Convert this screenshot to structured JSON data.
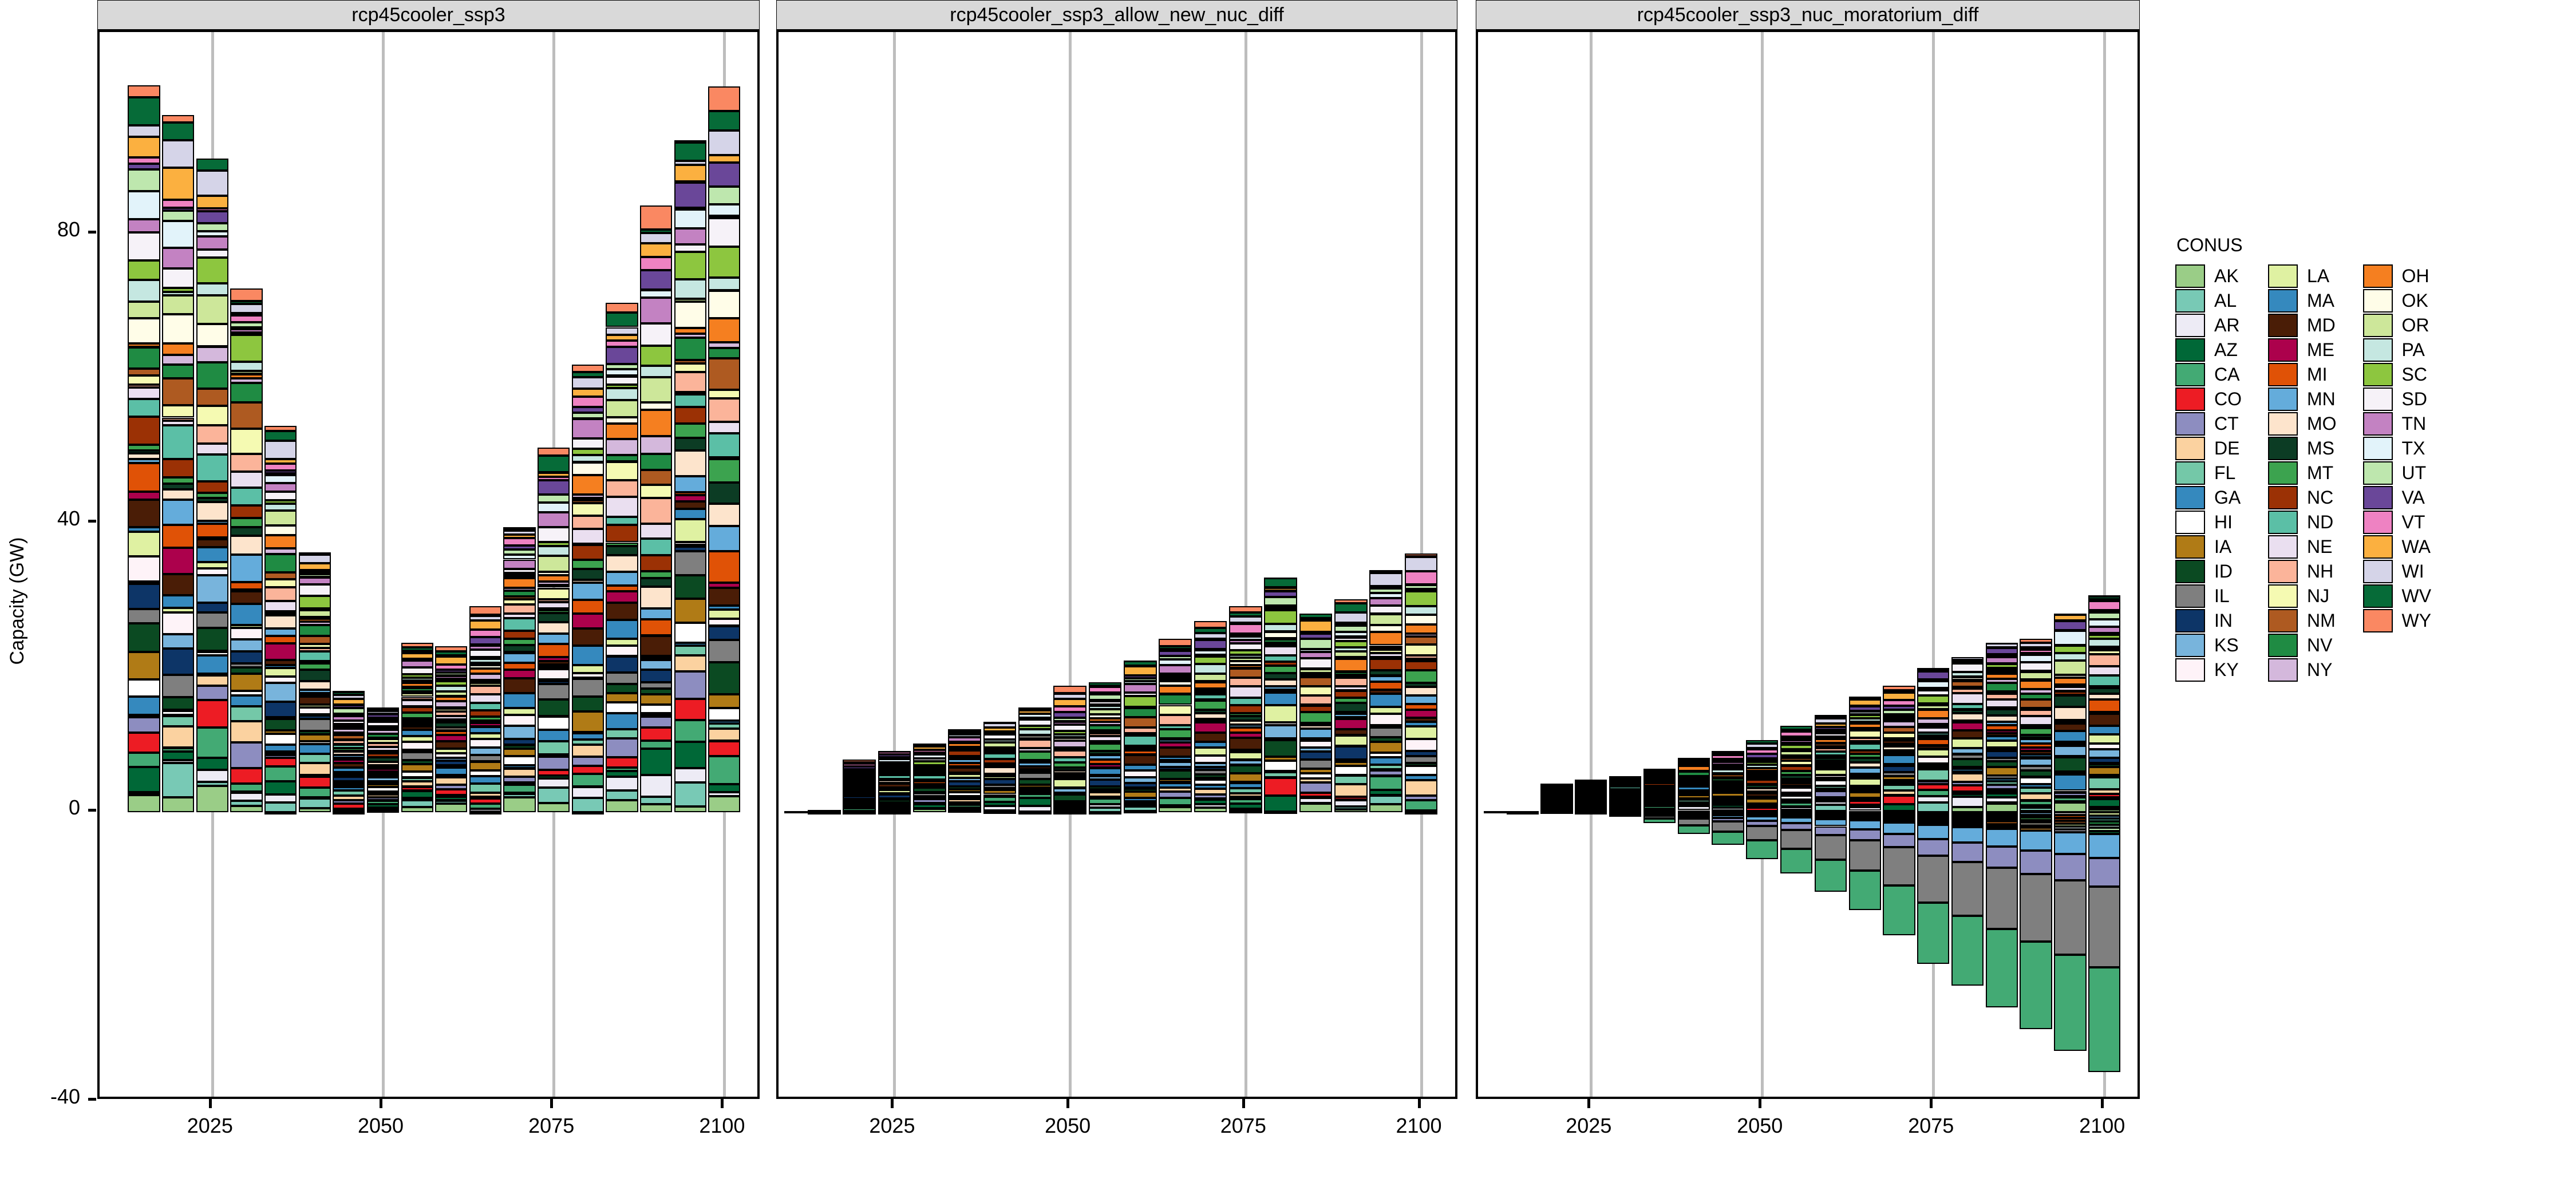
{
  "axes": {
    "ylabel": "Capacity (GW)",
    "yticks": [
      80,
      40,
      0,
      -40
    ],
    "ytick_labels": [
      "80",
      "40",
      "0",
      "-40"
    ],
    "ylim": [
      -40,
      108
    ],
    "xticks": [
      2025,
      2050,
      2075,
      2100
    ],
    "xtick_labels": [
      "2025",
      "2050",
      "2075",
      "2100"
    ],
    "xlim": [
      2008,
      2106
    ]
  },
  "legend": {
    "title": "CONUS",
    "columns": [
      [
        {
          "label": "AK",
          "color": "#9ACD87"
        },
        {
          "label": "AL",
          "color": "#78C9B5"
        },
        {
          "label": "AR",
          "color": "#EDEBF5"
        },
        {
          "label": "AZ",
          "color": "#006837"
        },
        {
          "label": "CA",
          "color": "#43AA74"
        },
        {
          "label": "CO",
          "color": "#ED1C24"
        },
        {
          "label": "CT",
          "color": "#8D8DC0"
        },
        {
          "label": "DE",
          "color": "#FBD2A0"
        },
        {
          "label": "FL",
          "color": "#74C8A8"
        },
        {
          "label": "GA",
          "color": "#3589BE"
        },
        {
          "label": "HI",
          "color": "#FFFFFF"
        },
        {
          "label": "IA",
          "color": "#B07B16"
        },
        {
          "label": "ID",
          "color": "#0B4A22"
        },
        {
          "label": "IL",
          "color": "#7F7F7F"
        },
        {
          "label": "IN",
          "color": "#0D3567"
        },
        {
          "label": "KS",
          "color": "#78B4DC"
        },
        {
          "label": "KY",
          "color": "#FEF3F8"
        }
      ],
      [
        {
          "label": "LA",
          "color": "#DFF1A2"
        },
        {
          "label": "MA",
          "color": "#3589BE"
        },
        {
          "label": "MD",
          "color": "#4A1D06"
        },
        {
          "label": "ME",
          "color": "#AC014C"
        },
        {
          "label": "MI",
          "color": "#E05206"
        },
        {
          "label": "MN",
          "color": "#64ACDB"
        },
        {
          "label": "MO",
          "color": "#FDE4CC"
        },
        {
          "label": "MS",
          "color": "#0C3C24"
        },
        {
          "label": "MT",
          "color": "#3CA34F"
        },
        {
          "label": "NC",
          "color": "#9B3105"
        },
        {
          "label": "ND",
          "color": "#5BBFA6"
        },
        {
          "label": "NE",
          "color": "#EADFF0"
        },
        {
          "label": "NH",
          "color": "#FBB49A"
        },
        {
          "label": "NJ",
          "color": "#F5FAB2"
        },
        {
          "label": "NM",
          "color": "#AE5A21"
        },
        {
          "label": "NV",
          "color": "#1F8B43"
        },
        {
          "label": "NY",
          "color": "#D4B8DC"
        }
      ],
      [
        {
          "label": "OH",
          "color": "#F57F20"
        },
        {
          "label": "OK",
          "color": "#FFFDE8"
        },
        {
          "label": "OR",
          "color": "#CDE79A"
        },
        {
          "label": "PA",
          "color": "#C5E7E1"
        },
        {
          "label": "SC",
          "color": "#8DC63F"
        },
        {
          "label": "SD",
          "color": "#F6F2F8"
        },
        {
          "label": "TN",
          "color": "#C382C2"
        },
        {
          "label": "TX",
          "color": "#E2F3FA"
        },
        {
          "label": "UT",
          "color": "#BEE7AE"
        },
        {
          "label": "VA",
          "color": "#6A4799"
        },
        {
          "label": "VT",
          "color": "#EE82C2"
        },
        {
          "label": "WA",
          "color": "#FBB040"
        },
        {
          "label": "WI",
          "color": "#D5D4E8"
        },
        {
          "label": "WV",
          "color": "#066B38"
        },
        {
          "label": "WY",
          "color": "#FA8862"
        }
      ]
    ]
  },
  "chart_data": {
    "type": "bar",
    "title": "",
    "xlabel": "",
    "ylabel": "Capacity (GW)",
    "stacked": true,
    "grid": "vertical",
    "legend_position": "right",
    "facets": [
      "rcp45cooler_ssp3",
      "rcp45cooler_ssp3_allow_new_nuc_diff",
      "rcp45cooler_ssp3_nuc_moratorium_diff"
    ],
    "x": [
      2015,
      2020,
      2025,
      2030,
      2035,
      2040,
      2045,
      2050,
      2055,
      2060,
      2065,
      2070,
      2075,
      2080,
      2085,
      2090,
      2095,
      2100
    ],
    "panels": [
      {
        "name": "rcp45cooler_ssp3",
        "totals": [
          100.6,
          96.5,
          90.5,
          72.5,
          53.5,
          36.0,
          16.8,
          14.5,
          23.5,
          23.0,
          28.5,
          39.5,
          50.5,
          62.0,
          70.5,
          84.0,
          93.0,
          100.5
        ],
        "negatives": [
          0,
          0,
          0,
          0,
          0,
          0,
          0,
          0,
          0,
          0,
          0,
          0,
          0,
          0,
          0,
          0,
          0,
          0
        ]
      },
      {
        "name": "rcp45cooler_ssp3_allow_new_nuc_diff",
        "totals": [
          0.3,
          7.3,
          8.5,
          9.5,
          11.5,
          12.5,
          14.5,
          17.5,
          18.0,
          21.0,
          24.0,
          26.5,
          28.5,
          32.5,
          27.5,
          29.5,
          33.5,
          35.8
        ],
        "negatives": [
          0,
          0,
          0,
          0,
          0,
          0,
          0,
          0,
          0,
          0,
          0,
          0,
          0,
          0,
          0,
          0,
          0,
          0
        ]
      },
      {
        "name": "rcp45cooler_ssp3_nuc_moratorium_diff",
        "totals": [
          0.2,
          4.0,
          4.5,
          5.0,
          6.0,
          7.5,
          8.5,
          10.0,
          12.0,
          13.5,
          16.0,
          17.5,
          20.0,
          21.5,
          23.5,
          24.0,
          27.5,
          30.0
        ],
        "negatives": [
          0,
          0,
          0,
          -0.5,
          -1.5,
          -3.0,
          -4.5,
          -6.5,
          -8.5,
          -11.0,
          -13.5,
          -17.0,
          -21.0,
          -24.0,
          -27.0,
          -30.0,
          -33.0,
          -36.0
        ]
      }
    ]
  }
}
